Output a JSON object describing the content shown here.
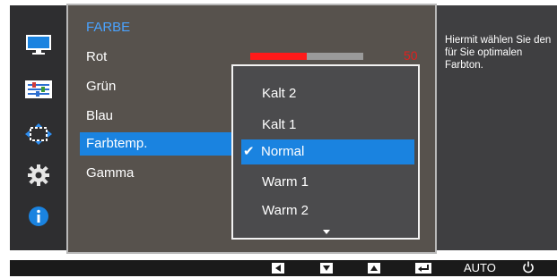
{
  "menu": {
    "title": "FARBE",
    "items": [
      {
        "label": "Rot"
      },
      {
        "label": "Grün"
      },
      {
        "label": "Blau"
      },
      {
        "label": "Farbtemp."
      },
      {
        "label": "Gamma"
      }
    ],
    "selected_item": "Farbtemp."
  },
  "rot_slider": {
    "value": "50",
    "level": 0.5
  },
  "dropdown": {
    "options": [
      {
        "label": "Kalt 2"
      },
      {
        "label": "Kalt 1"
      },
      {
        "label": "Normal"
      },
      {
        "label": "Warm 1"
      },
      {
        "label": "Warm 2"
      }
    ],
    "selected": "Normal"
  },
  "help_text": "Hiermit wählen Sie den für Sie optimalen Farbton.",
  "sidebar_icons": [
    "monitor-icon",
    "picture-settings-icon",
    "size-position-icon",
    "settings-gear-icon",
    "info-icon"
  ],
  "bottom_keys": {
    "auto_label": "AUTO"
  },
  "colors": {
    "accent": "#1a83e0",
    "title": "#4aa3ff",
    "slider_red": "#ff1a1a"
  }
}
